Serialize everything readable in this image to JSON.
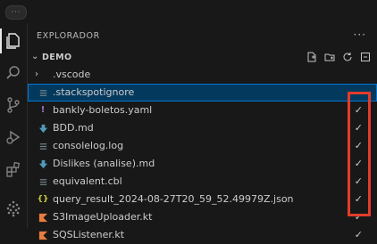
{
  "explorer": {
    "title": "EXPLORADOR",
    "more": "···",
    "section": "DEMO",
    "section_actions": [
      "new-file-icon",
      "new-folder-icon",
      "refresh-icon",
      "collapse-all-icon"
    ]
  },
  "activity_bar": [
    "files-icon",
    "search-icon",
    "source-control-icon",
    "run-debug-icon",
    "extensions-icon",
    "stackspot-icon"
  ],
  "colors": {
    "background": "#181818",
    "selection": "#04395e",
    "selection_border": "#0078d4",
    "annotation": "#e23c2a",
    "kotlin": "#e87d3e",
    "json": "#cbcb41",
    "markdown": "#519aba"
  },
  "files": [
    {
      "name": ".vscode",
      "type": "folder",
      "icon": "chevron-right-icon",
      "check": ""
    },
    {
      "name": ".stackspotignore",
      "type": "file",
      "icon": "lines-icon",
      "check": "",
      "selected": true
    },
    {
      "name": "bankly-boletos.yaml",
      "type": "file",
      "icon": "exclamation-icon",
      "check": "✓"
    },
    {
      "name": "BDD.md",
      "type": "file",
      "icon": "markdown-icon",
      "check": "✓"
    },
    {
      "name": "consolelog.log",
      "type": "file",
      "icon": "lines-icon",
      "check": "✓"
    },
    {
      "name": "Dislikes (analise).md",
      "type": "file",
      "icon": "markdown-icon",
      "check": "✓"
    },
    {
      "name": "equivalent.cbl",
      "type": "file",
      "icon": "lines-icon",
      "check": "✓"
    },
    {
      "name": "query_result_2024-08-27T20_59_52.49979Z.json",
      "type": "file",
      "icon": "json-icon",
      "check": "✓"
    },
    {
      "name": "S3ImageUploader.kt",
      "type": "file",
      "icon": "kotlin-icon",
      "check": "✓"
    },
    {
      "name": "SQSListener.kt",
      "type": "file",
      "icon": "kotlin-icon",
      "check": "✓"
    }
  ]
}
